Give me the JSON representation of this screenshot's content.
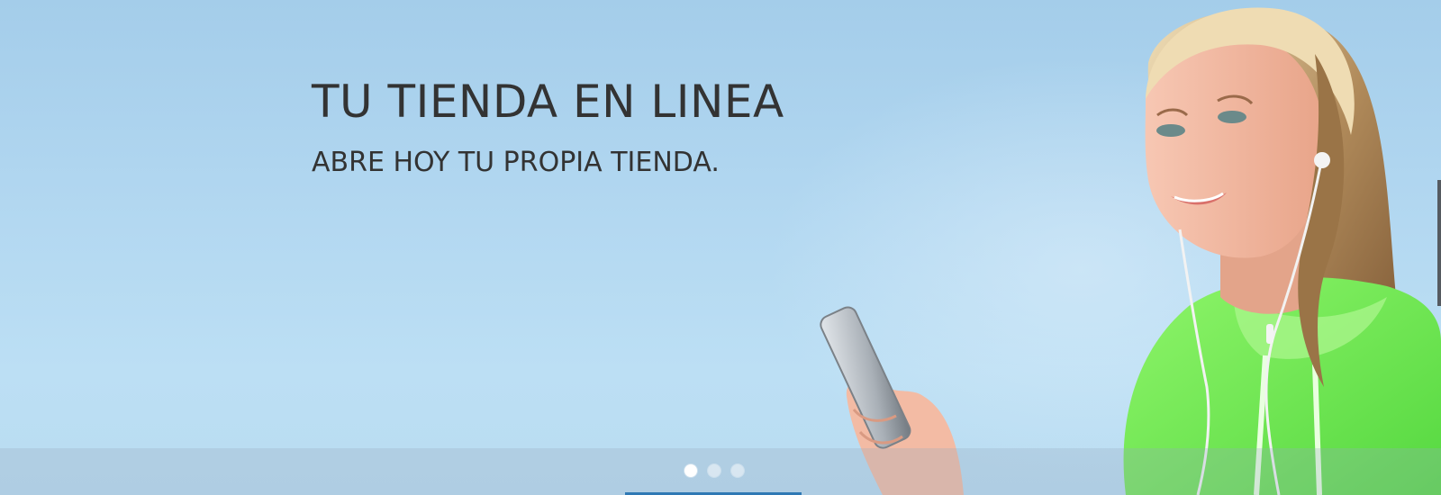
{
  "hero": {
    "headline": "TU TIENDA EN LINEA",
    "subheadline": "ABRE HOY TU PROPIA TIENDA."
  },
  "carousel": {
    "slide_count": 3,
    "active_index": 0,
    "dots": [
      {
        "active": true
      },
      {
        "active": false
      },
      {
        "active": false
      }
    ]
  },
  "colors": {
    "sky": "#b3d8f1",
    "text": "#333333",
    "accent": "#2f79b5",
    "hoodie": "#6cf04a"
  },
  "photo": {
    "subject": "woman-with-phone-and-earphones"
  }
}
